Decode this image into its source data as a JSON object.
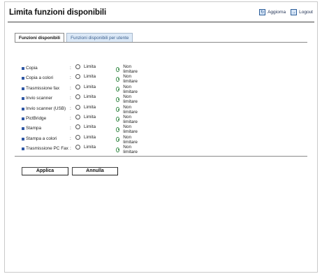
{
  "header": {
    "title": "Limita funzioni disponibili",
    "refresh_label": "Aggiorna",
    "logout_label": "Logout"
  },
  "tabs": [
    {
      "label": "Funzioni disponibili",
      "active": true
    },
    {
      "label": "Funzioni disponibili per utente",
      "active": false
    }
  ],
  "options": {
    "restrict": "Limita",
    "unrestricted": "Non limitare"
  },
  "functions": [
    {
      "name": "Copia",
      "selected": "Non limitare"
    },
    {
      "name": "Copia a colori",
      "selected": "Non limitare"
    },
    {
      "name": "Trasmissione fax",
      "selected": "Non limitare"
    },
    {
      "name": "Invio scanner",
      "selected": "Non limitare"
    },
    {
      "name": "Invio scanner (USB)",
      "selected": "Non limitare"
    },
    {
      "name": "PictBridge",
      "selected": "Non limitare"
    },
    {
      "name": "Stampa",
      "selected": "Non limitare"
    },
    {
      "name": "Stampa a colori",
      "selected": "Non limitare"
    },
    {
      "name": "Trasmissione PC Fax",
      "selected": "Non limitare"
    }
  ],
  "buttons": {
    "apply": "Applica",
    "cancel": "Annulla"
  },
  "colors": {
    "bullet": "#2f58a6",
    "tab_inactive": "#dce9f7",
    "radio_selected": "#2a8a3a"
  }
}
